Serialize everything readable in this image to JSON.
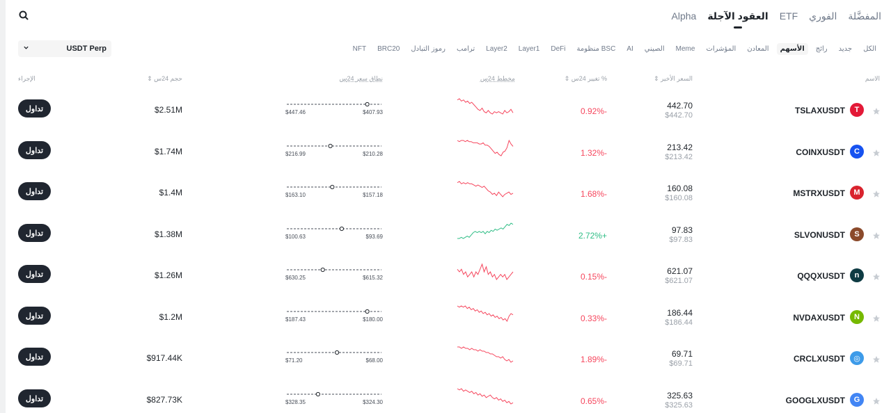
{
  "top_tabs": [
    {
      "label": "المفضَّلة",
      "active": false
    },
    {
      "label": "الفوري",
      "active": false
    },
    {
      "label": "ETF",
      "active": false
    },
    {
      "label": "العقود الآجلة",
      "active": true
    },
    {
      "label": "Alpha",
      "active": false
    }
  ],
  "select": {
    "label": "USDT Perp",
    "icon": "chevron-down-icon"
  },
  "filters": [
    {
      "label": "الكل",
      "active": false
    },
    {
      "label": "جديد",
      "active": false
    },
    {
      "label": "رائج",
      "active": false
    },
    {
      "label": "الأسهم",
      "active": true
    },
    {
      "label": "المعادن",
      "active": false
    },
    {
      "label": "المؤشرات",
      "active": false
    },
    {
      "label": "Meme",
      "active": false
    },
    {
      "label": "الصيني",
      "active": false
    },
    {
      "label": "AI",
      "active": false
    },
    {
      "label": "منظومة BSC",
      "active": false
    },
    {
      "label": "DeFi",
      "active": false
    },
    {
      "label": "Layer1",
      "active": false
    },
    {
      "label": "Layer2",
      "active": false
    },
    {
      "label": "ترامب",
      "active": false
    },
    {
      "label": "رموز التبادل",
      "active": false
    },
    {
      "label": "BRC20",
      "active": false
    },
    {
      "label": "NFT",
      "active": false
    }
  ],
  "headers": {
    "name": "الاسم",
    "last_price": "السعر الأخير",
    "change": "تغيير 24س %",
    "chart": "مخطط 24س",
    "range": "نطاق سعر 24س",
    "volume": "حجم 24س",
    "action": "الإجراء"
  },
  "colors": {
    "negative": "#f6465d",
    "positive": "#2ebd85",
    "button": "#202630"
  },
  "rows": [
    {
      "symbol": "TSLAXUSDT",
      "icon": "tesla-icon",
      "icon_color": "#e31937",
      "icon_glyph": "T",
      "price": "442.70",
      "mark": "$442.70",
      "change": "0.92%-",
      "direction": "neg",
      "range_low": "$447.46",
      "range_high": "$407.93",
      "range_position": 0.85,
      "volume": "$2.51M",
      "trade": "تداول",
      "spark": [
        20,
        19,
        21,
        20,
        22,
        21,
        23,
        22,
        24,
        26,
        28,
        29,
        27,
        30,
        31,
        29,
        31,
        32,
        30,
        31,
        30,
        31,
        32,
        29,
        31,
        30,
        28,
        31
      ]
    },
    {
      "symbol": "COINXUSDT",
      "icon": "coinbase-icon",
      "icon_color": "#1652f0",
      "icon_glyph": "C",
      "price": "213.42",
      "mark": "$213.42",
      "change": "1.32%-",
      "direction": "neg",
      "range_low": "$216.99",
      "range_high": "$210.28",
      "range_position": 0.46,
      "volume": "$1.74M",
      "trade": "تداول",
      "spark": [
        20,
        21,
        20,
        20,
        21,
        20,
        21,
        21,
        22,
        22,
        22,
        23,
        23,
        22,
        24,
        24,
        25,
        27,
        29,
        31,
        30,
        32,
        33,
        30,
        29,
        26,
        20,
        23,
        25
      ]
    },
    {
      "symbol": "MSTRXUSDT",
      "icon": "strategy-icon",
      "icon_color": "#d9232e",
      "icon_glyph": "M",
      "price": "160.08",
      "mark": "$160.08",
      "change": "1.68%-",
      "direction": "neg",
      "range_low": "$163.10",
      "range_high": "$157.18",
      "range_position": 0.48,
      "volume": "$1.4M",
      "trade": "تداول",
      "spark": [
        20,
        19,
        21,
        20,
        21,
        20,
        21,
        21,
        22,
        23,
        22,
        23,
        24,
        23,
        25,
        27,
        28,
        30,
        29,
        31,
        28,
        30,
        32,
        30,
        29,
        28,
        30,
        29
      ]
    },
    {
      "symbol": "SLVONUSDT",
      "icon": "silver-icon",
      "icon_color": "#8b4a2b",
      "icon_glyph": "S",
      "price": "97.83",
      "mark": "$97.83",
      "change": "2.72%+",
      "direction": "pos",
      "range_low": "$100.63",
      "range_high": "$93.69",
      "range_position": 0.58,
      "volume": "$1.38M",
      "trade": "تداول",
      "spark": [
        30,
        30,
        29,
        30,
        29,
        28,
        29,
        27,
        25,
        24,
        25,
        24,
        25,
        24,
        26,
        24,
        25,
        23,
        24,
        22,
        23,
        22,
        21,
        22,
        20,
        18,
        19,
        17,
        18
      ]
    },
    {
      "symbol": "QQQXUSDT",
      "icon": "nasdaq-icon",
      "icon_color": "#0e3b43",
      "icon_glyph": "n",
      "price": "621.07",
      "mark": "$621.07",
      "change": "0.15%-",
      "direction": "neg",
      "range_low": "$630.25",
      "range_high": "$615.32",
      "range_position": 0.38,
      "volume": "$1.26M",
      "trade": "تداول",
      "spark": [
        24,
        25,
        24,
        26,
        25,
        27,
        26,
        25,
        27,
        25,
        26,
        24,
        22,
        25,
        23,
        26,
        25,
        27,
        26,
        28,
        27,
        26,
        27,
        26,
        28,
        27,
        26,
        25
      ]
    },
    {
      "symbol": "NVDAXUSDT",
      "icon": "nvidia-icon",
      "icon_color": "#76b900",
      "icon_glyph": "N",
      "price": "186.44",
      "mark": "$186.44",
      "change": "0.33%-",
      "direction": "neg",
      "range_low": "$187.43",
      "range_high": "$180.00",
      "range_position": 0.85,
      "volume": "$1.2M",
      "trade": "تداول",
      "spark": [
        20,
        21,
        20,
        21,
        20,
        22,
        21,
        23,
        22,
        24,
        23,
        25,
        24,
        26,
        25,
        27,
        26,
        28,
        27,
        29,
        28,
        30,
        29,
        31,
        30,
        32,
        28,
        26,
        27
      ]
    },
    {
      "symbol": "CRCLXUSDT",
      "icon": "circle-icon",
      "icon_color": "#3d9be9",
      "icon_glyph": "◎",
      "price": "69.71",
      "mark": "$69.71",
      "change": "1.89%-",
      "direction": "neg",
      "range_low": "$71.20",
      "range_high": "$68.00",
      "range_position": 0.53,
      "volume": "$917.44K",
      "trade": "تداول",
      "spark": [
        20,
        20,
        21,
        20,
        21,
        21,
        22,
        21,
        22,
        22,
        23,
        22,
        23,
        23,
        24,
        24,
        25,
        25,
        26,
        27,
        27,
        28,
        27,
        29,
        30,
        29,
        31,
        30
      ]
    },
    {
      "symbol": "GOOGLXUSDT",
      "icon": "google-icon",
      "icon_color": "#4285f4",
      "icon_glyph": "G",
      "price": "325.63",
      "mark": "$325.63",
      "change": "0.65%-",
      "direction": "neg",
      "range_low": "$328.35",
      "range_high": "$324.30",
      "range_position": 0.33,
      "volume": "$827.73K",
      "trade": "تداول",
      "spark": [
        20,
        21,
        20,
        22,
        21,
        22,
        23,
        22,
        24,
        23,
        25,
        24,
        26,
        25,
        27,
        26,
        25,
        27,
        28,
        27,
        29,
        28,
        30,
        29,
        31,
        30,
        32,
        31
      ]
    }
  ]
}
